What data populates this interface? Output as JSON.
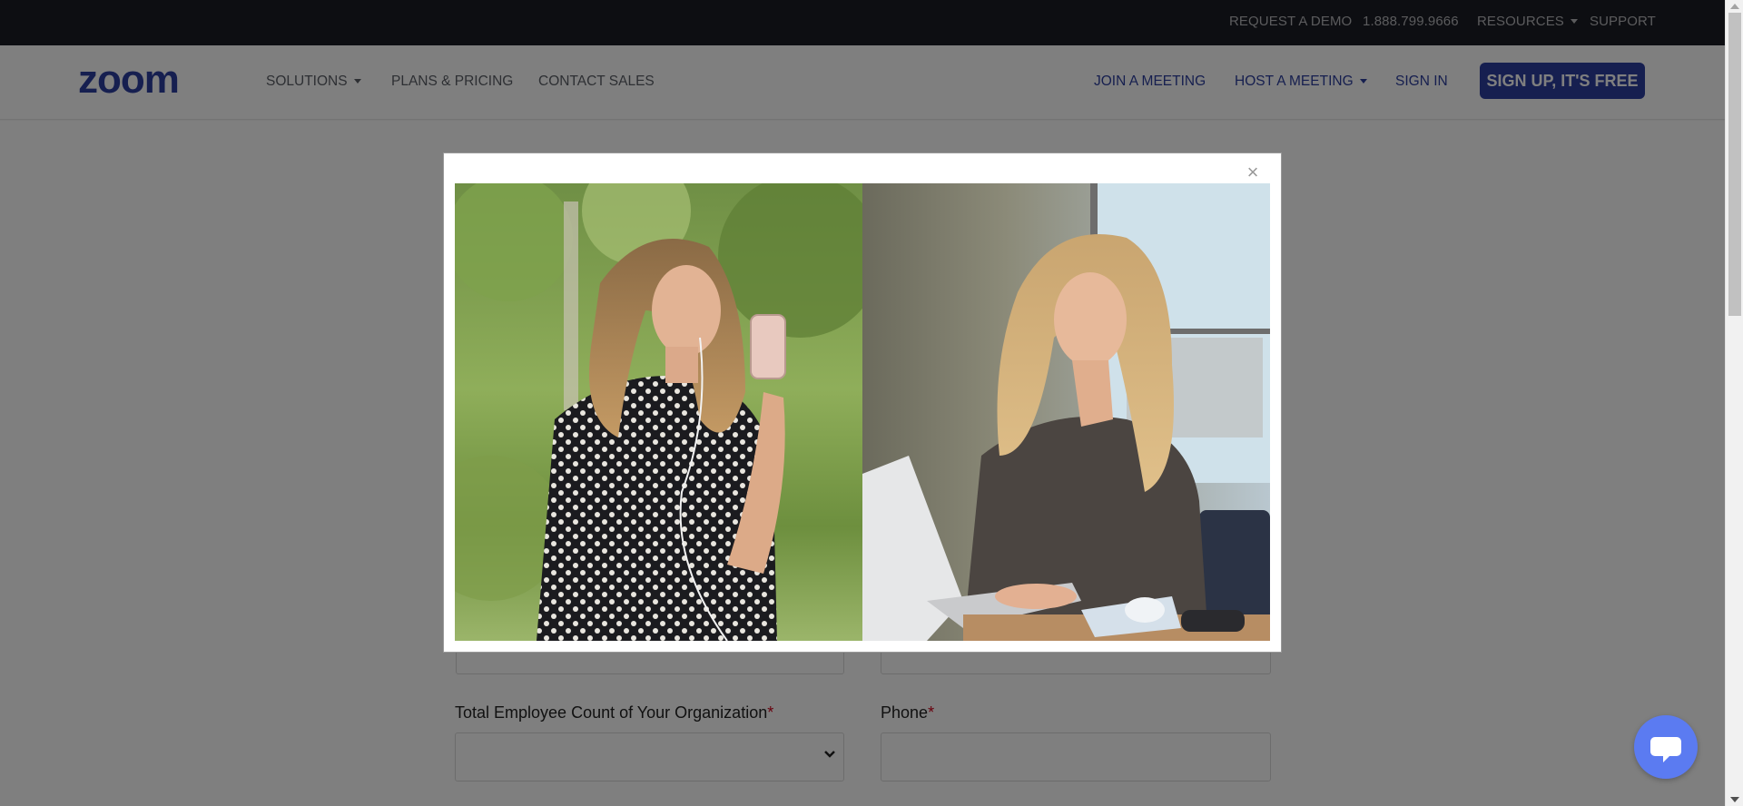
{
  "topbar": {
    "request_demo": "REQUEST A DEMO",
    "phone": "1.888.799.9666",
    "resources": "RESOURCES",
    "support": "SUPPORT"
  },
  "nav": {
    "logo_text": "zoom",
    "solutions": "SOLUTIONS",
    "plans_pricing": "PLANS & PRICING",
    "contact_sales": "CONTACT SALES",
    "join_meeting": "JOIN A MEETING",
    "host_meeting": "HOST A MEETING",
    "sign_in": "SIGN IN",
    "signup_button": "SIGN UP, IT'S FREE"
  },
  "form": {
    "employee_count_label": "Total Employee Count of Your Organization",
    "employee_count_value": "",
    "phone_label": "Phone",
    "phone_value": "",
    "required_mark": "*"
  },
  "modal": {
    "close_label": "×",
    "image_description": "Two women in a split-screen video call: one on a phone outdoors, one at a laptop in an office"
  },
  "colors": {
    "topbar_bg": "#1b1d24",
    "brand_blue": "#2d3fa1",
    "chat_blue": "#5b7bf1",
    "required_red": "#d0021b"
  },
  "icons": {
    "chat": "chat-bubble-icon",
    "close": "close-icon",
    "dropdown": "caret-down-icon"
  }
}
